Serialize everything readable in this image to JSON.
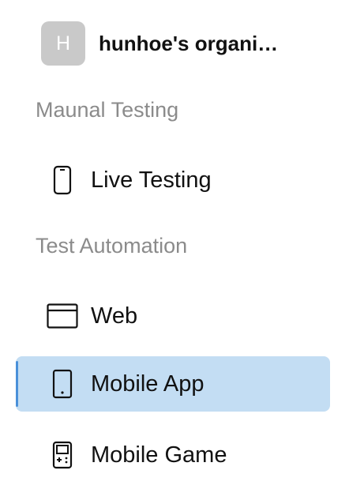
{
  "org": {
    "avatar_letter": "H",
    "name": "hunhoe's organi…"
  },
  "sections": {
    "manual": {
      "title": "Maunal Testing",
      "items": [
        {
          "label": "Live Testing",
          "icon": "mobile-phone-icon"
        }
      ]
    },
    "automation": {
      "title": "Test Automation",
      "items": [
        {
          "label": "Web",
          "icon": "browser-window-icon"
        },
        {
          "label": "Mobile App",
          "icon": "mobile-device-icon",
          "active": true
        },
        {
          "label": "Mobile Game",
          "icon": "game-device-icon"
        }
      ]
    }
  },
  "colors": {
    "active_background": "#c3ddf3",
    "active_indicator": "#4a90d9",
    "section_title": "#8b8b8b",
    "avatar_background": "#c9c9c9"
  }
}
